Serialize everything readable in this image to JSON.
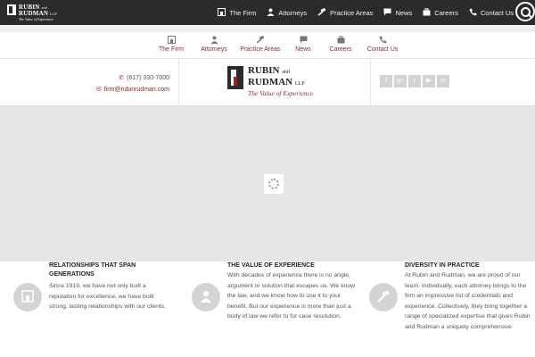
{
  "top_logo": {
    "line1": "RUBIN",
    "line1_small": "and",
    "line2": "RUDMAN",
    "line2_small": "LLP",
    "tagline": "The Value of Experience"
  },
  "top_nav": [
    {
      "label": "The Firm",
      "icon": "building-icon"
    },
    {
      "label": "Attorneys",
      "icon": "person-icon"
    },
    {
      "label": "Practice Areas",
      "icon": "gavel-icon"
    },
    {
      "label": "News",
      "icon": "chat-icon"
    },
    {
      "label": "Careers",
      "icon": "briefcase-icon"
    },
    {
      "label": "Contact Us",
      "icon": "phone-icon"
    }
  ],
  "sub_nav": [
    {
      "label": "The Firm",
      "icon": "building-icon"
    },
    {
      "label": "Attorneys",
      "icon": "person-icon"
    },
    {
      "label": "Practice Areas",
      "icon": "gavel-icon"
    },
    {
      "label": "News",
      "icon": "chat-icon"
    },
    {
      "label": "Careers",
      "icon": "briefcase-icon"
    },
    {
      "label": "Contact Us",
      "icon": "phone-icon"
    }
  ],
  "contact": {
    "phone": "(617) 330-7000",
    "email": "firm@rubinrudman.com"
  },
  "header_logo": {
    "line1": "RUBIN",
    "line1_small": "and",
    "line2": "RUDMAN",
    "line2_small": "LLP",
    "tagline": "The Value of Experience"
  },
  "social": [
    {
      "glyph": "f",
      "icon": "facebook-icon"
    },
    {
      "glyph": "g+",
      "icon": "google-plus-icon"
    },
    {
      "glyph": "t",
      "icon": "twitter-icon"
    },
    {
      "glyph": "▶",
      "icon": "youtube-icon"
    },
    {
      "glyph": "in",
      "icon": "linkedin-icon"
    }
  ],
  "features": [
    {
      "title": "Relationships That Span Generations",
      "body": "Since 1919, we have not only built a reputation for excellence, we have built strong, lasting relationships with our clients."
    },
    {
      "title": "The Value of Experience",
      "body": "With decades of experience there is no angle, argument or solution that escapes us. We know the law, and we know how to use it to your benefit. But our experience is more than just a body of law we refer to for case resolution."
    },
    {
      "title": "Diversity in Practice",
      "body": "At Rubin and Rudman, we are proud of our team. Individually, each attorney brings to the firm an impressive list of credentials and experience. Collectively, they bring together a range of specialized expertise that gives Rubin and Rudman a uniquely comprehensive"
    }
  ],
  "colors": {
    "brand_red": "#8a2626",
    "topbar": "#2b2b2b",
    "slider_bg": "#e6e6e6"
  }
}
